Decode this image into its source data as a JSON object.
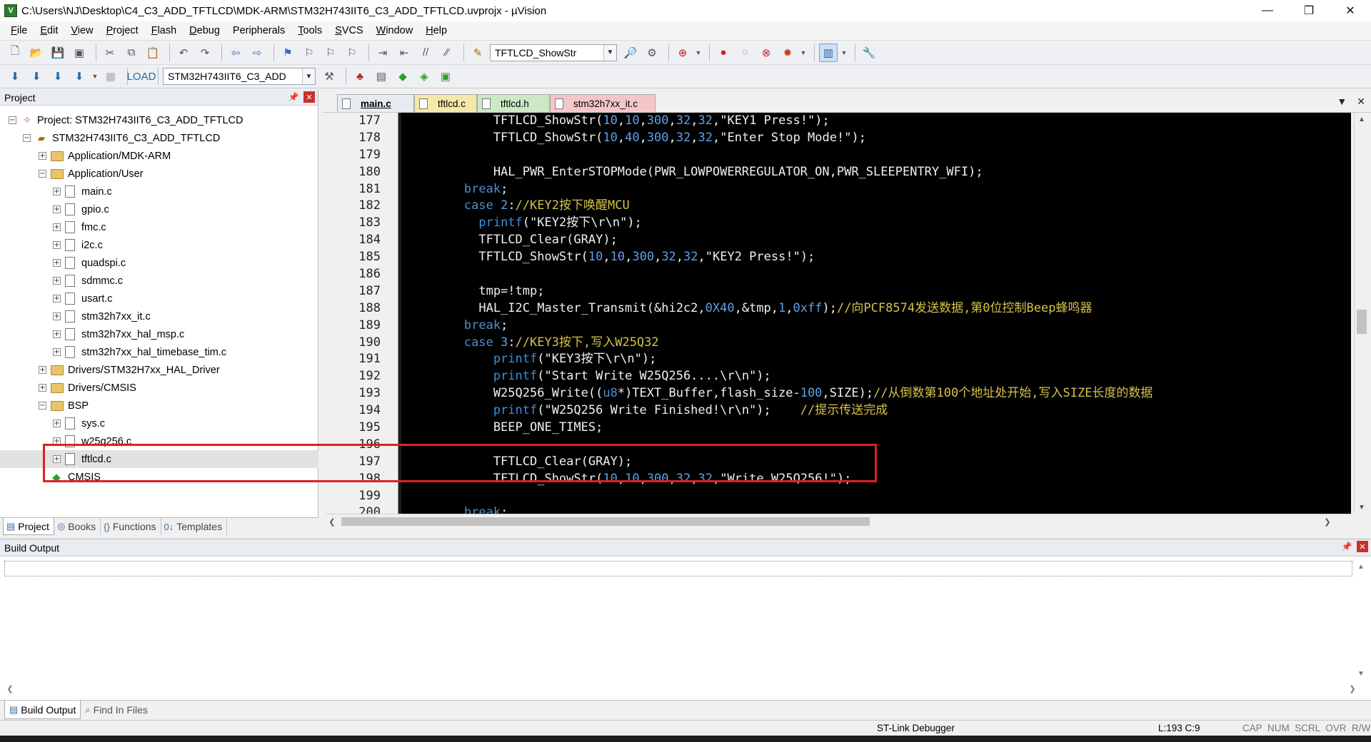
{
  "window": {
    "title": "C:\\Users\\NJ\\Desktop\\C4_C3_ADD_TFTLCD\\MDK-ARM\\STM32H743IIT6_C3_ADD_TFTLCD.uvprojx - µVision",
    "minimize": "—",
    "maximize": "❐",
    "close": "✕"
  },
  "menu": [
    {
      "u": "F",
      "rest": "ile"
    },
    {
      "u": "E",
      "rest": "dit"
    },
    {
      "u": "V",
      "rest": "iew"
    },
    {
      "u": "P",
      "rest": "roject"
    },
    {
      "u": "F",
      "rest": "lash"
    },
    {
      "u": "D",
      "rest": "ebug"
    },
    {
      "u": "",
      "rest": "Peripherals"
    },
    {
      "u": "T",
      "rest": "ools"
    },
    {
      "u": "S",
      "rest": "VCS"
    },
    {
      "u": "W",
      "rest": "indow"
    },
    {
      "u": "H",
      "rest": "elp"
    }
  ],
  "toolbar": {
    "find_combo": "TFTLCD_ShowStr",
    "target_combo": "STM32H743IIT6_C3_ADD"
  },
  "project_panel": {
    "title": "Project",
    "tree": [
      {
        "label": "Project: STM32H743IIT6_C3_ADD_TFTLCD",
        "level": 0,
        "icon": "project-icon",
        "exp": "-"
      },
      {
        "label": "STM32H743IIT6_C3_ADD_TFTLCD",
        "level": 1,
        "icon": "target-icon",
        "exp": "-"
      },
      {
        "label": "Application/MDK-ARM",
        "level": 2,
        "icon": "folder-icon",
        "exp": "+"
      },
      {
        "label": "Application/User",
        "level": 2,
        "icon": "folder-icon",
        "exp": "-"
      },
      {
        "label": "main.c",
        "level": 3,
        "icon": "file-icon",
        "exp": "+"
      },
      {
        "label": "gpio.c",
        "level": 3,
        "icon": "file-icon",
        "exp": "+"
      },
      {
        "label": "fmc.c",
        "level": 3,
        "icon": "file-icon",
        "exp": "+"
      },
      {
        "label": "i2c.c",
        "level": 3,
        "icon": "file-icon",
        "exp": "+"
      },
      {
        "label": "quadspi.c",
        "level": 3,
        "icon": "file-icon",
        "exp": "+"
      },
      {
        "label": "sdmmc.c",
        "level": 3,
        "icon": "file-icon",
        "exp": "+"
      },
      {
        "label": "usart.c",
        "level": 3,
        "icon": "file-icon",
        "exp": "+"
      },
      {
        "label": "stm32h7xx_it.c",
        "level": 3,
        "icon": "file-icon",
        "exp": "+"
      },
      {
        "label": "stm32h7xx_hal_msp.c",
        "level": 3,
        "icon": "file-icon",
        "exp": "+"
      },
      {
        "label": "stm32h7xx_hal_timebase_tim.c",
        "level": 3,
        "icon": "file-icon",
        "exp": "+"
      },
      {
        "label": "Drivers/STM32H7xx_HAL_Driver",
        "level": 2,
        "icon": "folder-icon",
        "exp": "+"
      },
      {
        "label": "Drivers/CMSIS",
        "level": 2,
        "icon": "folder-icon",
        "exp": "+"
      },
      {
        "label": "BSP",
        "level": 2,
        "icon": "folder-icon",
        "exp": "-"
      },
      {
        "label": "sys.c",
        "level": 3,
        "icon": "file-icon",
        "exp": "+"
      },
      {
        "label": "w25q256.c",
        "level": 3,
        "icon": "file-icon",
        "exp": "+"
      },
      {
        "label": "tftlcd.c",
        "level": 3,
        "icon": "file-icon",
        "exp": "+",
        "selected": true
      },
      {
        "label": "CMSIS",
        "level": 2,
        "icon": "cmsis-icon",
        "exp": ""
      }
    ],
    "tabs": [
      {
        "label": "Project",
        "icon": "▤",
        "active": true
      },
      {
        "label": "Books",
        "icon": "◎"
      },
      {
        "label": "Functions",
        "icon": "{}"
      },
      {
        "label": "Templates",
        "icon": "0↓"
      }
    ]
  },
  "editor": {
    "tabs": [
      "main.c",
      "tftlcd.c",
      "tftlcd.h",
      "stm32h7xx_it.c"
    ],
    "line_numbers": [
      "177",
      "178",
      "179",
      "180",
      "181",
      "182",
      "183",
      "184",
      "185",
      "186",
      "187",
      "188",
      "189",
      "190",
      "191",
      "192",
      "193",
      "194",
      "195",
      "196",
      "197",
      "198",
      "199",
      "200"
    ],
    "lines": [
      [
        {
          "t": "            TFTLCD_ShowStr(",
          "c": ""
        },
        {
          "t": "10",
          "c": "num"
        },
        {
          "t": ",",
          "c": ""
        },
        {
          "t": "10",
          "c": "num"
        },
        {
          "t": ",",
          "c": ""
        },
        {
          "t": "300",
          "c": "num"
        },
        {
          "t": ",",
          "c": ""
        },
        {
          "t": "32",
          "c": "num"
        },
        {
          "t": ",",
          "c": ""
        },
        {
          "t": "32",
          "c": "num"
        },
        {
          "t": ",\"KEY1 Press!\");",
          "c": ""
        }
      ],
      [
        {
          "t": "            TFTLCD_ShowStr(",
          "c": ""
        },
        {
          "t": "10",
          "c": "num"
        },
        {
          "t": ",",
          "c": ""
        },
        {
          "t": "40",
          "c": "num"
        },
        {
          "t": ",",
          "c": ""
        },
        {
          "t": "300",
          "c": "num"
        },
        {
          "t": ",",
          "c": ""
        },
        {
          "t": "32",
          "c": "num"
        },
        {
          "t": ",",
          "c": ""
        },
        {
          "t": "32",
          "c": "num"
        },
        {
          "t": ",\"Enter Stop Mode!\");",
          "c": ""
        }
      ],
      [
        {
          "t": "",
          "c": ""
        }
      ],
      [
        {
          "t": "            HAL_PWR_EnterSTOPMode(PWR_LOWPOWERREGULATOR_ON,PWR_SLEEPENTRY_WFI);",
          "c": ""
        }
      ],
      [
        {
          "t": "        ",
          "c": ""
        },
        {
          "t": "break",
          "c": "kw"
        },
        {
          "t": ";",
          "c": ""
        }
      ],
      [
        {
          "t": "        ",
          "c": ""
        },
        {
          "t": "case ",
          "c": "kw"
        },
        {
          "t": "2",
          "c": "num"
        },
        {
          "t": ":",
          "c": ""
        },
        {
          "t": "//KEY2按下唤醒MCU",
          "c": "cm"
        }
      ],
      [
        {
          "t": "          ",
          "c": ""
        },
        {
          "t": "printf",
          "c": "lib"
        },
        {
          "t": "(\"KEY2按下\\r\\n\");",
          "c": ""
        }
      ],
      [
        {
          "t": "          TFTLCD_Clear(GRAY);",
          "c": ""
        }
      ],
      [
        {
          "t": "          TFTLCD_ShowStr(",
          "c": ""
        },
        {
          "t": "10",
          "c": "num"
        },
        {
          "t": ",",
          "c": ""
        },
        {
          "t": "10",
          "c": "num"
        },
        {
          "t": ",",
          "c": ""
        },
        {
          "t": "300",
          "c": "num"
        },
        {
          "t": ",",
          "c": ""
        },
        {
          "t": "32",
          "c": "num"
        },
        {
          "t": ",",
          "c": ""
        },
        {
          "t": "32",
          "c": "num"
        },
        {
          "t": ",\"KEY2 Press!\");",
          "c": ""
        }
      ],
      [
        {
          "t": "",
          "c": ""
        }
      ],
      [
        {
          "t": "          tmp=!tmp;",
          "c": ""
        }
      ],
      [
        {
          "t": "          HAL_I2C_Master_Transmit(&hi2c2,",
          "c": ""
        },
        {
          "t": "0X40",
          "c": "num"
        },
        {
          "t": ",&tmp,",
          "c": ""
        },
        {
          "t": "1",
          "c": "num"
        },
        {
          "t": ",",
          "c": ""
        },
        {
          "t": "0xff",
          "c": "num"
        },
        {
          "t": ");",
          "c": ""
        },
        {
          "t": "//向PCF8574发送数据,第0位控制Beep蜂鸣器",
          "c": "cm"
        }
      ],
      [
        {
          "t": "        ",
          "c": ""
        },
        {
          "t": "break",
          "c": "kw"
        },
        {
          "t": ";",
          "c": ""
        }
      ],
      [
        {
          "t": "        ",
          "c": ""
        },
        {
          "t": "case ",
          "c": "kw"
        },
        {
          "t": "3",
          "c": "num"
        },
        {
          "t": ":",
          "c": ""
        },
        {
          "t": "//KEY3按下,写入W25Q32",
          "c": "cm"
        }
      ],
      [
        {
          "t": "            ",
          "c": ""
        },
        {
          "t": "printf",
          "c": "lib"
        },
        {
          "t": "(\"KEY3按下\\r\\n\");",
          "c": ""
        }
      ],
      [
        {
          "t": "            ",
          "c": ""
        },
        {
          "t": "printf",
          "c": "lib"
        },
        {
          "t": "(\"Start Write W25Q256....\\r\\n\");",
          "c": ""
        }
      ],
      [
        {
          "t": "            W25Q256_Write((",
          "c": ""
        },
        {
          "t": "u8",
          "c": "kw"
        },
        {
          "t": "*)TEXT_Buffer,flash_size-",
          "c": ""
        },
        {
          "t": "100",
          "c": "num"
        },
        {
          "t": ",SIZE);",
          "c": ""
        },
        {
          "t": "//从倒数第100个地址处开始,写入SIZE长度的数据",
          "c": "cm"
        }
      ],
      [
        {
          "t": "            ",
          "c": ""
        },
        {
          "t": "printf",
          "c": "lib"
        },
        {
          "t": "(\"W25Q256 Write Finished!\\r\\n\");    ",
          "c": ""
        },
        {
          "t": "//提示传送完成",
          "c": "cm"
        }
      ],
      [
        {
          "t": "            BEEP_ONE_TIMES;",
          "c": ""
        }
      ],
      [
        {
          "t": "",
          "c": ""
        }
      ],
      [
        {
          "t": "            TFTLCD_Clear(GRAY);",
          "c": ""
        }
      ],
      [
        {
          "t": "            TFTLCD_ShowStr(",
          "c": ""
        },
        {
          "t": "10",
          "c": "num"
        },
        {
          "t": ",",
          "c": ""
        },
        {
          "t": "10",
          "c": "num"
        },
        {
          "t": ",",
          "c": ""
        },
        {
          "t": "300",
          "c": "num"
        },
        {
          "t": ",",
          "c": ""
        },
        {
          "t": "32",
          "c": "num"
        },
        {
          "t": ",",
          "c": ""
        },
        {
          "t": "32",
          "c": "num"
        },
        {
          "t": ",\"Write W25Q256!\");",
          "c": ""
        }
      ],
      [
        {
          "t": "",
          "c": ""
        }
      ],
      [
        {
          "t": "        ",
          "c": ""
        },
        {
          "t": "break",
          "c": "kw"
        },
        {
          "t": ";",
          "c": ""
        }
      ]
    ]
  },
  "build_output": {
    "title": "Build Output",
    "tabs": [
      {
        "label": "Build Output",
        "icon": "▤",
        "active": true
      },
      {
        "label": "Find In Files",
        "icon": "⌕"
      }
    ]
  },
  "status": {
    "debugger": "ST-Link Debugger",
    "position": "L:193 C:9",
    "flags": "CAP  NUM  SCRL  OVR  R/W"
  }
}
